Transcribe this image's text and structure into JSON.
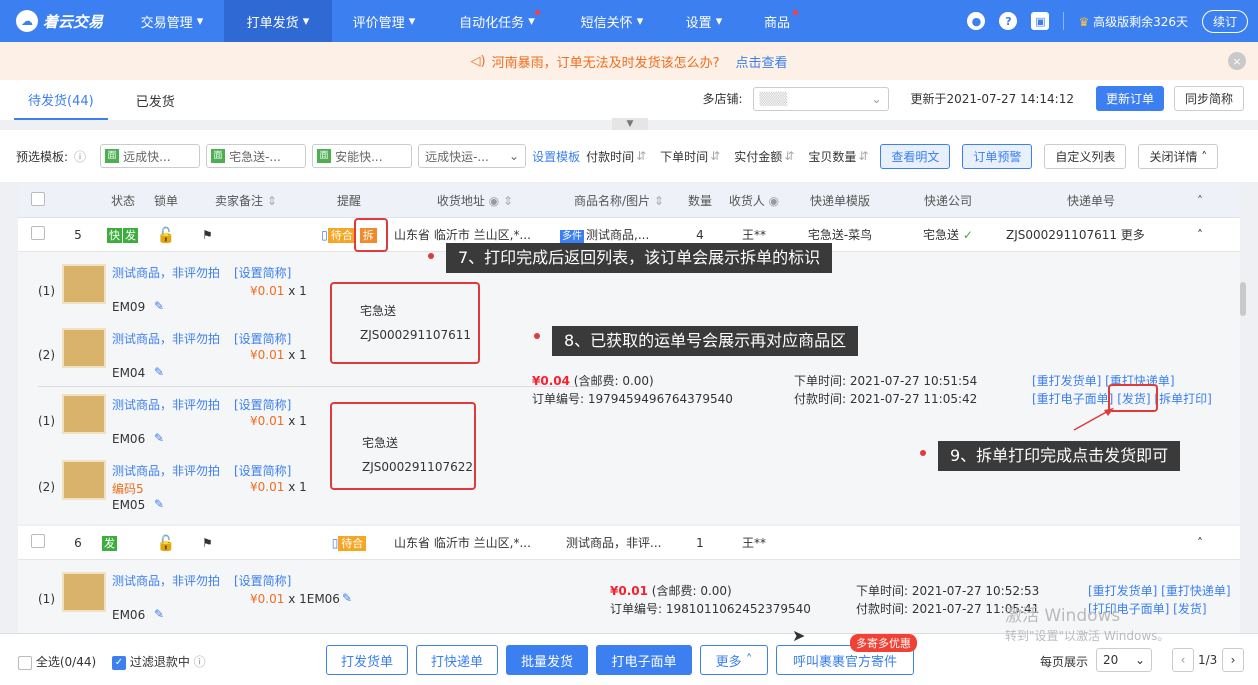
{
  "app": {
    "logo": "着云交易"
  },
  "nav": {
    "items": [
      "交易管理",
      "打单发货",
      "评价管理",
      "自动化任务",
      "短信关怀",
      "设置",
      "商品"
    ],
    "edition": "高级版剩余326天",
    "renew": "续订"
  },
  "banner": {
    "text": "河南暴雨，订单无法及时发货该怎么办?",
    "link": "点击查看"
  },
  "tabs": {
    "pending": "待发货(44)",
    "shipped": "已发货"
  },
  "subbar": {
    "shop_label": "多店铺:",
    "updated": "更新于2021-07-27 14:14:12",
    "update_btn": "更新订单",
    "sync_btn": "同步简称"
  },
  "toolbar": {
    "preset": "预选模板:",
    "templates": [
      "远成快...",
      "宅急送-...",
      "安能快..."
    ],
    "template_select": "远成快运-...",
    "set_template": "设置模板",
    "sorts": [
      "付款时间",
      "下单时间",
      "实付金额",
      "宝贝数量"
    ],
    "view_plain": "查看明文",
    "warn": "订单预警",
    "custom_cols": "自定义列表",
    "close_detail": "关闭详情"
  },
  "columns": [
    "状态",
    "锁单",
    "卖家备注",
    "提醒",
    "收货地址",
    "商品名称/图片",
    "数量",
    "收货人",
    "快递单模版",
    "快递公司",
    "快递单号"
  ],
  "orders": [
    {
      "no": "5",
      "status": [
        "快",
        "发"
      ],
      "remind": "待合",
      "split": "拆",
      "address": "山东省 临沂市 兰山区,*...",
      "multi": "多件",
      "goods": "测试商品,...",
      "qty": "4",
      "receiver": "王**",
      "template": "宅急送-菜鸟",
      "company": "宅急送",
      "tracking": "ZJS000291107611 更多"
    },
    {
      "no": "6",
      "status": [
        "发"
      ],
      "remind": "待合",
      "address": "山东省 临沂市 兰山区,*...",
      "goods": "测试商品，非评...",
      "qty": "1",
      "receiver": "王**"
    }
  ],
  "items": [
    {
      "idx": "(1)",
      "name": "测试商品，非评勿拍",
      "set": "[设置简称]",
      "price": "¥0.01",
      "qty": "x 1",
      "code": "EM09"
    },
    {
      "idx": "(2)",
      "name": "测试商品，非评勿拍",
      "set": "[设置简称]",
      "price": "¥0.01",
      "qty": "x 1",
      "code": "EM04"
    },
    {
      "idx": "(1)",
      "name": "测试商品，非评勿拍",
      "set": "[设置简称]",
      "price": "¥0.01",
      "qty": "x 1",
      "code": "EM06"
    },
    {
      "idx": "(2)",
      "name": "测试商品，非评勿拍",
      "set": "[设置简称]",
      "extra": "编码5",
      "price": "¥0.01",
      "qty": "x 1",
      "code": "EM05"
    },
    {
      "idx": "(1)",
      "name": "测试商品，非评勿拍",
      "set": "[设置简称]",
      "price": "¥0.01",
      "qty": "x 1EM06",
      "code": "EM06"
    }
  ],
  "waybills": [
    {
      "carrier": "宅急送",
      "number": "ZJS000291107611"
    },
    {
      "carrier": "宅急送",
      "number": "ZJS000291107622"
    }
  ],
  "order5": {
    "total": "¥0.04",
    "postage": "(含邮费: 0.00)",
    "order_no": "订单编号: 1979459496764379540",
    "order_time": "下单时间: 2021-07-27 10:51:54",
    "pay_time": "付款时间: 2021-07-27 11:05:42",
    "actions1": "[重打发货单] [重打快递单]",
    "reprint": "[重打电子面单]",
    "ship": "[发货]",
    "split_print": "[拆单打印]"
  },
  "order6": {
    "total": "¥0.01",
    "postage": "(含邮费: 0.00)",
    "order_no": "订单编号: 1981011062452379540",
    "order_time": "下单时间: 2021-07-27 10:52:53",
    "pay_time": "付款时间: 2021-07-27 11:05:41",
    "actions1": "[重打发货单] [重打快递单]",
    "actions2": "[打印电子面单] [发货]"
  },
  "callouts": {
    "c7": "7、打印完成后返回列表，该订单会展示拆单的标识",
    "c8": "8、已获取的运单号会展示再对应商品区",
    "c9": "9、拆单打印完成点击发货即可"
  },
  "footer": {
    "select_all": "全选(0/44)",
    "filter": "过滤退款中",
    "buttons": [
      "打发货单",
      "打快递单",
      "批量发货",
      "打电子面单",
      "更多",
      "呼叫裹裹官方寄件"
    ],
    "promo": "多寄多优惠",
    "page_label": "每页展示",
    "page_size": "20",
    "page": "1/3"
  },
  "watermark": {
    "line1": "激活 Windows",
    "line2": "转到\"设置\"以激活 Windows。"
  }
}
